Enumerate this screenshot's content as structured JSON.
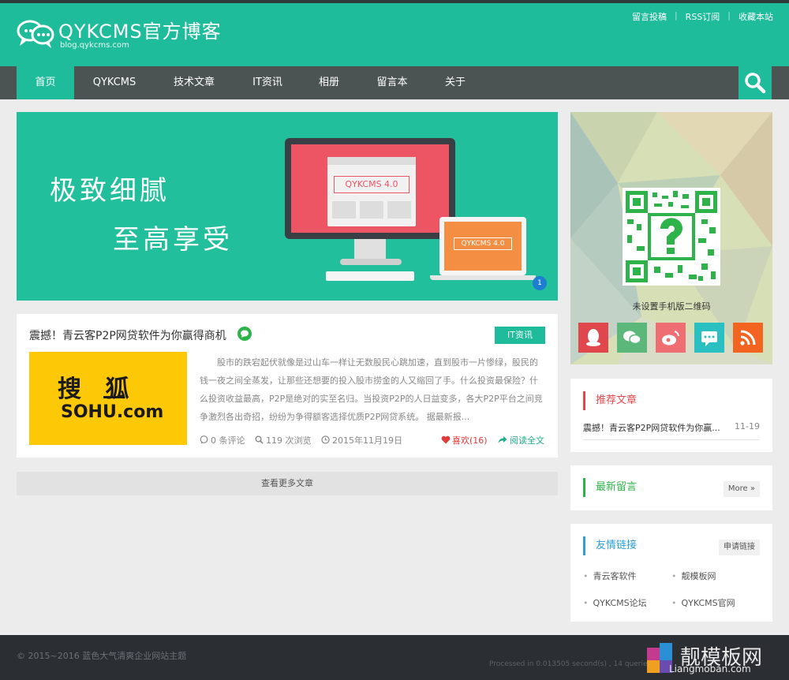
{
  "site": {
    "title": "QYKCMS官方博客",
    "subtitle": "blog.qykcms.com"
  },
  "toplinks": [
    "留言投稿",
    "RSS订阅",
    "收藏本站"
  ],
  "nav": {
    "items": [
      "首页",
      "QYKCMS",
      "技术文章",
      "IT资讯",
      "相册",
      "留言本",
      "关于"
    ],
    "active_index": 0
  },
  "banner": {
    "slogan_line1": "极致细腻",
    "slogan_line2": "至高享受",
    "monitor_label": "QYKCMS 4.0",
    "laptop_label": "QYKCMS 4.0",
    "slide_number": "1"
  },
  "article": {
    "title": "震撼！青云客P2P网贷软件为你赢得商机",
    "tag": "IT资讯",
    "thumb_text_top": "搜 狐",
    "thumb_text_bottom": "SOHU.com",
    "summary": "股市的跌宕起伏就像是过山车一样让无数股民心跳加速，直到股市一片惨绿，股民的钱一夜之间全蒸发，让那些还想要的投入股市捞金的人又缩回了手。什么投资最保险？什么投资收益最高，P2P是绝对的实至名归。当投资P2P的人日益变多，各大P2P平台之间竞争激烈各出奇招，纷纷为争得额客选择优质P2P网贷系统。     据最新报...",
    "comments": "0 条评论",
    "views": "119 次浏览",
    "date": "2015年11月19日",
    "likes": "喜欢(16)",
    "read_more": "阅读全文"
  },
  "more_articles": "查看更多文章",
  "sidebar": {
    "qr_caption": "未设置手机版二维码",
    "social_icons": [
      {
        "name": "qq-icon",
        "color": "#e0474c"
      },
      {
        "name": "wechat-icon",
        "color": "#5cb87a"
      },
      {
        "name": "weibo-icon",
        "color": "#ee6e73"
      },
      {
        "name": "message-icon",
        "color": "#2ac0c1"
      },
      {
        "name": "rss-icon",
        "color": "#f2641f"
      }
    ],
    "recommended": {
      "title": "推荐文章",
      "item_title": "震撼！青云客P2P网贷软件为你赢...",
      "item_date": "11-19"
    },
    "latest_comments": {
      "title": "最新留言",
      "more": "More »"
    },
    "friend_links": {
      "title": "友情链接",
      "apply": "申请链接",
      "links": [
        "青云客软件",
        "靓模板网",
        "QYKCMS论坛",
        "QYKCMS官网"
      ]
    }
  },
  "footer": {
    "copyright": "© 2015~2016 蓝色大气清爽企业网站主题",
    "processed": "Processed in 0.013505 second(s) , 14 queries",
    "watermark_title": "靓模板网",
    "watermark_url": "Liangmoban.com"
  },
  "colors": {
    "accent": "#1fbc9c",
    "nav_bg": "#4b5453",
    "footer_bg": "#2b2e33"
  }
}
